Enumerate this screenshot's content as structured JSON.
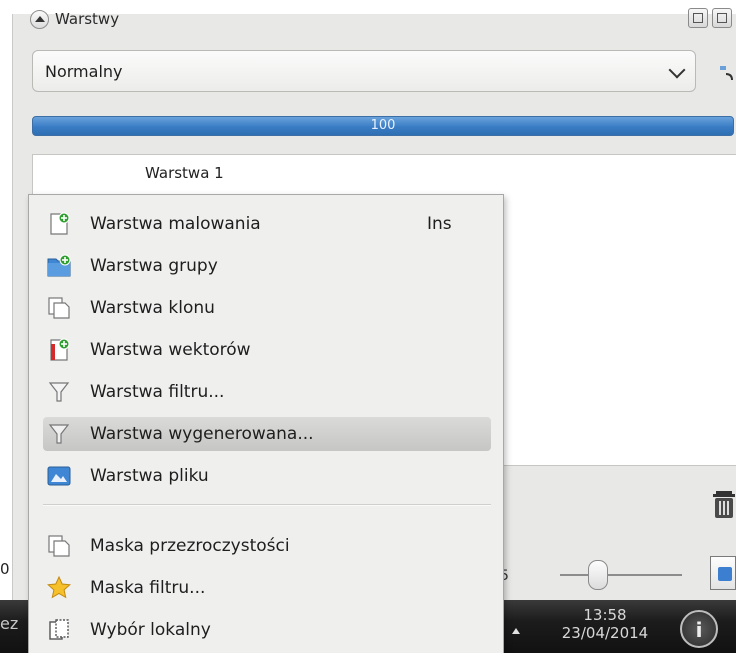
{
  "docker": {
    "title": "Warstwy"
  },
  "blend_mode": {
    "selected": "Normalny"
  },
  "opacity": {
    "value": "100",
    "fraction": 1.0
  },
  "layers": [
    {
      "name": "Warstwa 1"
    }
  ],
  "context_menu": {
    "items": [
      {
        "label": "Warstwa malowania",
        "shortcut": "Ins",
        "icon": "paint-layer-icon"
      },
      {
        "label": "Warstwa grupy",
        "shortcut": "",
        "icon": "group-layer-icon"
      },
      {
        "label": "Warstwa klonu",
        "shortcut": "",
        "icon": "clone-layer-icon"
      },
      {
        "label": "Warstwa wektorów",
        "shortcut": "",
        "icon": "vector-layer-icon"
      },
      {
        "label": "Warstwa filtru...",
        "shortcut": "",
        "icon": "filter-layer-icon"
      },
      {
        "label": "Warstwa wygenerowana...",
        "shortcut": "",
        "icon": "generated-layer-icon",
        "highlighted": true
      },
      {
        "label": "Warstwa pliku",
        "shortcut": "",
        "icon": "file-layer-icon"
      },
      {
        "label": "Maska przezroczystości",
        "shortcut": "",
        "icon": "transparency-mask-icon"
      },
      {
        "label": "Maska filtru...",
        "shortcut": "",
        "icon": "filter-mask-icon"
      },
      {
        "label": "Wybór lokalny",
        "shortcut": "",
        "icon": "local-selection-icon"
      }
    ]
  },
  "status": {
    "zoom_fragment": "5",
    "left_fragment": "0"
  },
  "taskbar": {
    "left_text": "ez",
    "time": "13:58",
    "date": "23/04/2014"
  },
  "colors": {
    "accent": "#3a7cc4",
    "menu_bg": "#efefee",
    "panel_bg": "#e8e8e7"
  }
}
